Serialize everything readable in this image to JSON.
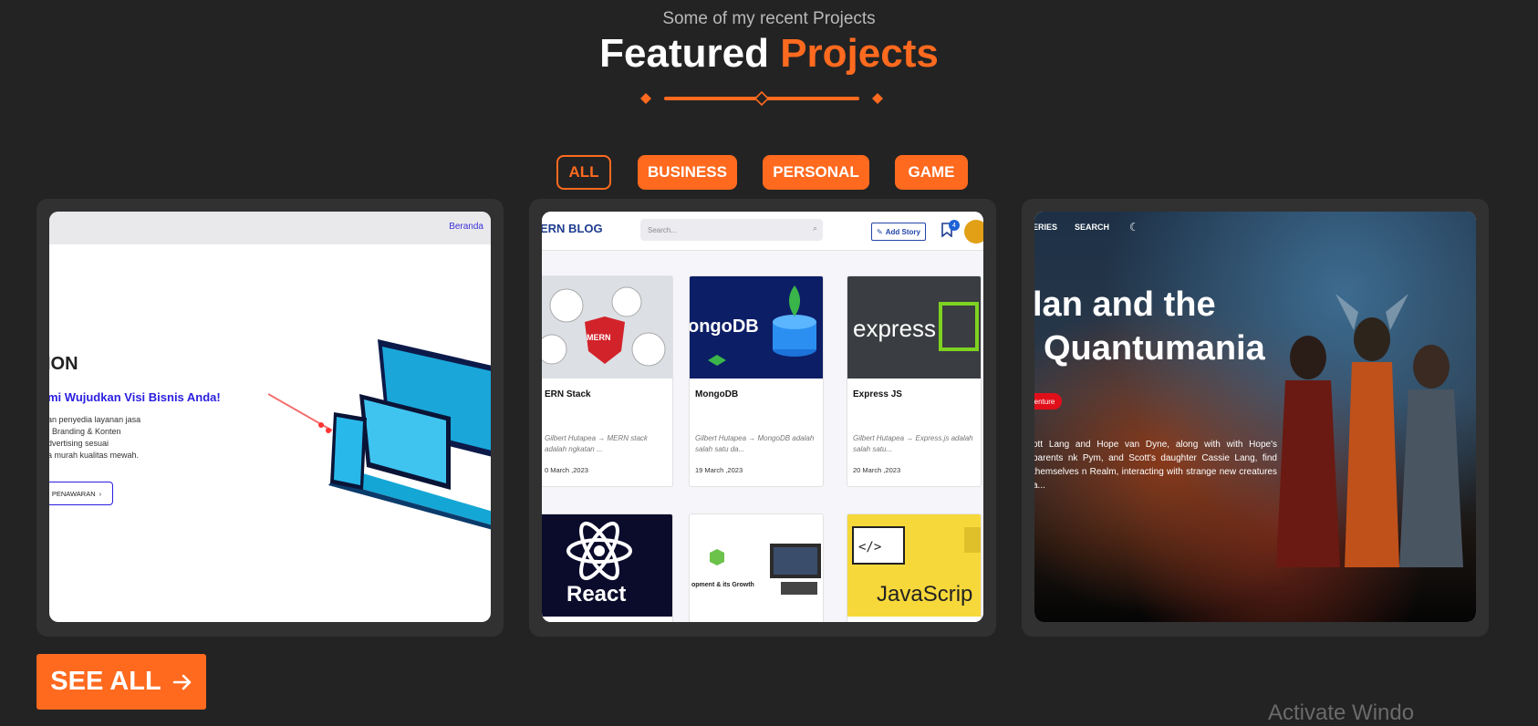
{
  "header": {
    "subtitle": "Some of my recent Projects",
    "title_main": "Featured",
    "title_accent": "Projects"
  },
  "filters": [
    {
      "label": "ALL",
      "active": true
    },
    {
      "label": "BUSINESS",
      "active": false
    },
    {
      "label": "PERSONAL",
      "active": false
    },
    {
      "label": "GAME",
      "active": false
    }
  ],
  "projects": {
    "business": {
      "nav_link": "Beranda",
      "heading": "ION",
      "subheading": "mi Wujudkan Visi Bisnis Anda!",
      "body_lines": [
        "an penyedia layanan jasa",
        ". Branding & Konten",
        "dvertising sesuai",
        "a murah kualitas mewah."
      ],
      "cta": "PENAWARAN"
    },
    "blog": {
      "logo": "ERN BLOG",
      "search_placeholder": "Search...",
      "add_story": "Add Story",
      "notif_count": "4",
      "posts": [
        {
          "image_text": "MERN",
          "title": "ERN Stack",
          "desc": "Gilbert Hutapea → MERN stack adalah ngkatan ...",
          "date": "0 March ,2023"
        },
        {
          "image_text": "ongoDB",
          "title": "MongoDB",
          "desc": "Gilbert Hutapea → MongoDB adalah salah satu da...",
          "date": "19 March ,2023"
        },
        {
          "image_text": "express",
          "title": "Express JS",
          "desc": "Gilbert Hutapea → Express.js adalah salah satu...",
          "date": "20 March ,2023"
        },
        {
          "image_text": "React"
        },
        {
          "image_text": "opment & its Growth"
        },
        {
          "image_text": "JavaScrip"
        }
      ]
    },
    "movie": {
      "nav_items": [
        "ERIES",
        "SEARCH"
      ],
      "title_line1": "lan and the",
      "title_line2": "Quantumania",
      "tag": "enture",
      "description": "ott Lang and Hope van Dyne, along with with Hope's parents nk Pym, and Scott's daughter Cassie Lang, find themselves n Realm, interacting with strange new creatures a..."
    }
  },
  "see_all": {
    "label": "SEE ALL"
  },
  "watermark": "Activate Windo",
  "colors": {
    "accent": "#ff6a1f",
    "background": "#232323",
    "card": "#313131"
  }
}
